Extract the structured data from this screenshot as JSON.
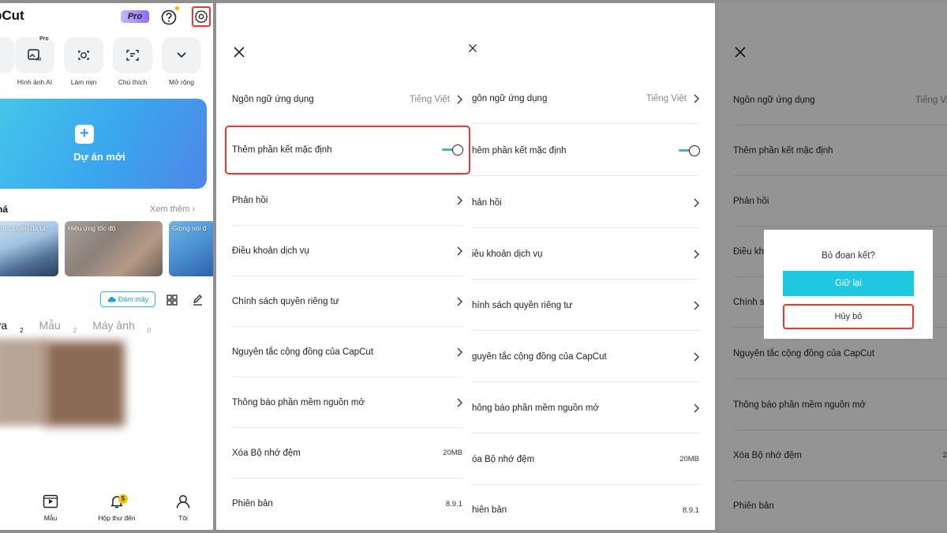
{
  "home": {
    "logo": "pCut",
    "pro_badge": "Pro",
    "tool_pro_tag": "Pro",
    "tools": [
      {
        "label": "Hình ảnh AI",
        "icon": "ai-image-icon"
      },
      {
        "label": "Làm mịn",
        "icon": "retouch-icon"
      },
      {
        "label": "Chú thích",
        "icon": "caption-icon"
      },
      {
        "label": "Mở rộng",
        "icon": "chevron-down-icon"
      }
    ],
    "new_project": "Dự án mới",
    "section_title": "há",
    "see_more": "Xem thêm",
    "thumbnails": [
      "trực tuyến đã ta",
      "Hiệu ứng tốc độ",
      "Giọng nói đ"
    ],
    "cloud_button": "Đám mây",
    "tabs": [
      {
        "label": "ửa",
        "count": "2"
      },
      {
        "label": "Mẫu",
        "count": "2"
      },
      {
        "label": "Máy ảnh",
        "count": "0"
      }
    ],
    "bottom_nav": {
      "templates": "Mẫu",
      "inbox": "Hộp thư đến",
      "inbox_badge": "5",
      "me": "Tôi"
    }
  },
  "settings": {
    "language": {
      "label": "Ngôn ngữ ứng dụng",
      "value": "Tiếng Việt"
    },
    "default_ending": {
      "label": "Thêm phần kết mặc định",
      "enabled": true
    },
    "feedback": "Phản hồi",
    "terms": "Điều khoản dịch vụ",
    "privacy": "Chính sách quyền riêng tư",
    "community": "Nguyên tắc cộng đồng của CapCut",
    "open_source": "Thông báo phần mềm nguồn mở",
    "clear_cache": {
      "label": "Xóa Bộ nhớ đệm",
      "value": "20MB"
    },
    "version": {
      "label": "Phiên bản",
      "value": "8.9.1"
    }
  },
  "settings_mid": {
    "language": "gôn ngữ ứng dụng",
    "language_value": "Tiếng Việt",
    "default_ending": "hêm phần kết mặc định",
    "feedback": "hản hồi",
    "terms": "iều khoản dịch vụ",
    "privacy": "hính sách quyền riêng tư",
    "community": "guyên tắc cộng đồng của CapCut",
    "open_source": "hông báo phần mềm nguồn mở",
    "clear_cache": "óa Bộ nhớ đệm",
    "clear_cache_value": "20MB",
    "version": "hiên bản",
    "version_value": "8.9.1"
  },
  "settings_dialog": {
    "language": "Ngôn ngữ ứng dụng",
    "language_value": "Tiếng Việt",
    "default_ending": "Thêm phần kết mặc định",
    "feedback": "Phản hồi",
    "terms": "Điều kh",
    "privacy": "Chính s",
    "community": "Nguyên tắc cộng đồng của CapCut",
    "open_source": "Thông báo phần mềm nguồn mở",
    "clear_cache": "Xóa Bộ nhớ đệm",
    "clear_cache_value": "2",
    "version": "Phiên bản"
  },
  "dialog": {
    "title": "Bỏ đoạn kết?",
    "keep": "Giữ lại",
    "cancel": "Hủy bỏ"
  },
  "colors": {
    "accent_cyan": "#1ec8e0",
    "highlight_red": "#e53935",
    "toggle_track": "#4bb3c0"
  }
}
